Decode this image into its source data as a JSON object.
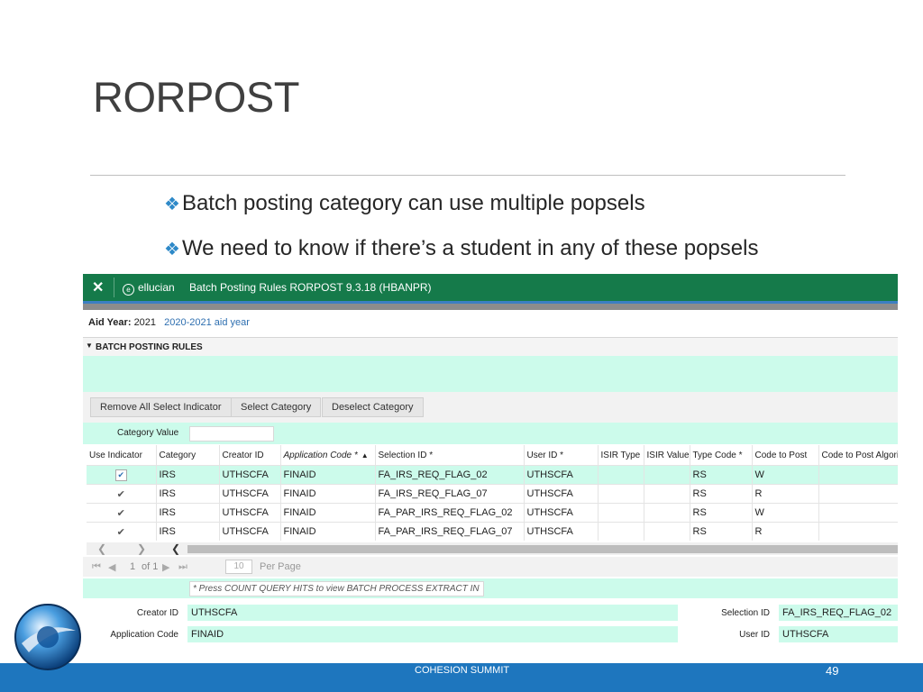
{
  "slide": {
    "title": "RORPOST",
    "bullets": [
      "Batch posting category can use multiple popsels",
      "We need to know if there’s a student in any of these popsels"
    ],
    "footer": "COHESION SUMMIT",
    "page_number": "49"
  },
  "app": {
    "close_icon": "✕",
    "brand": "ellucian",
    "form_title": "Batch Posting Rules RORPOST 9.3.18 (HBANPR)",
    "aid_year_label": "Aid Year:",
    "aid_year_value": "2021",
    "aid_year_desc": "2020-2021 aid year",
    "section_title": "BATCH POSTING RULES",
    "buttons": [
      "Remove All Select Indicator",
      "Select Category",
      "Deselect Category"
    ],
    "category_value_label": "Category Value",
    "columns": [
      "Use Indicator",
      "Category",
      "Creator ID",
      "Application Code *",
      "Selection ID *",
      "User ID *",
      "ISIR Type",
      "ISIR Value",
      "Type Code *",
      "Code to Post",
      "Code to Post Algori"
    ],
    "rows": [
      {
        "category": "IRS",
        "creator": "UTHSCFA",
        "app_code": "FINAID",
        "selection": "FA_IRS_REQ_FLAG_02",
        "user": "UTHSCFA",
        "isir_type": "",
        "isir_value": "",
        "type_code": "RS",
        "code_post": "W",
        "algo": ""
      },
      {
        "category": "IRS",
        "creator": "UTHSCFA",
        "app_code": "FINAID",
        "selection": "FA_IRS_REQ_FLAG_07",
        "user": "UTHSCFA",
        "isir_type": "",
        "isir_value": "",
        "type_code": "RS",
        "code_post": "R",
        "algo": ""
      },
      {
        "category": "IRS",
        "creator": "UTHSCFA",
        "app_code": "FINAID",
        "selection": "FA_PAR_IRS_REQ_FLAG_02",
        "user": "UTHSCFA",
        "isir_type": "",
        "isir_value": "",
        "type_code": "RS",
        "code_post": "W",
        "algo": ""
      },
      {
        "category": "IRS",
        "creator": "UTHSCFA",
        "app_code": "FINAID",
        "selection": "FA_PAR_IRS_REQ_FLAG_07",
        "user": "UTHSCFA",
        "isir_type": "",
        "isir_value": "",
        "type_code": "RS",
        "code_post": "R",
        "algo": ""
      }
    ],
    "pager": {
      "page": "1",
      "of_label": "of 1",
      "per_page": "10",
      "per_page_label": "Per Page"
    },
    "note": "* Press COUNT QUERY HITS to view BATCH PROCESS EXTRACT IN",
    "detail": {
      "creator_label": "Creator ID",
      "creator_value": "UTHSCFA",
      "app_label": "Application Code",
      "app_value": "FINAID",
      "selection_label": "Selection ID",
      "selection_value": "FA_IRS_REQ_FLAG_02",
      "user_label": "User ID",
      "user_value": "UTHSCFA"
    }
  }
}
